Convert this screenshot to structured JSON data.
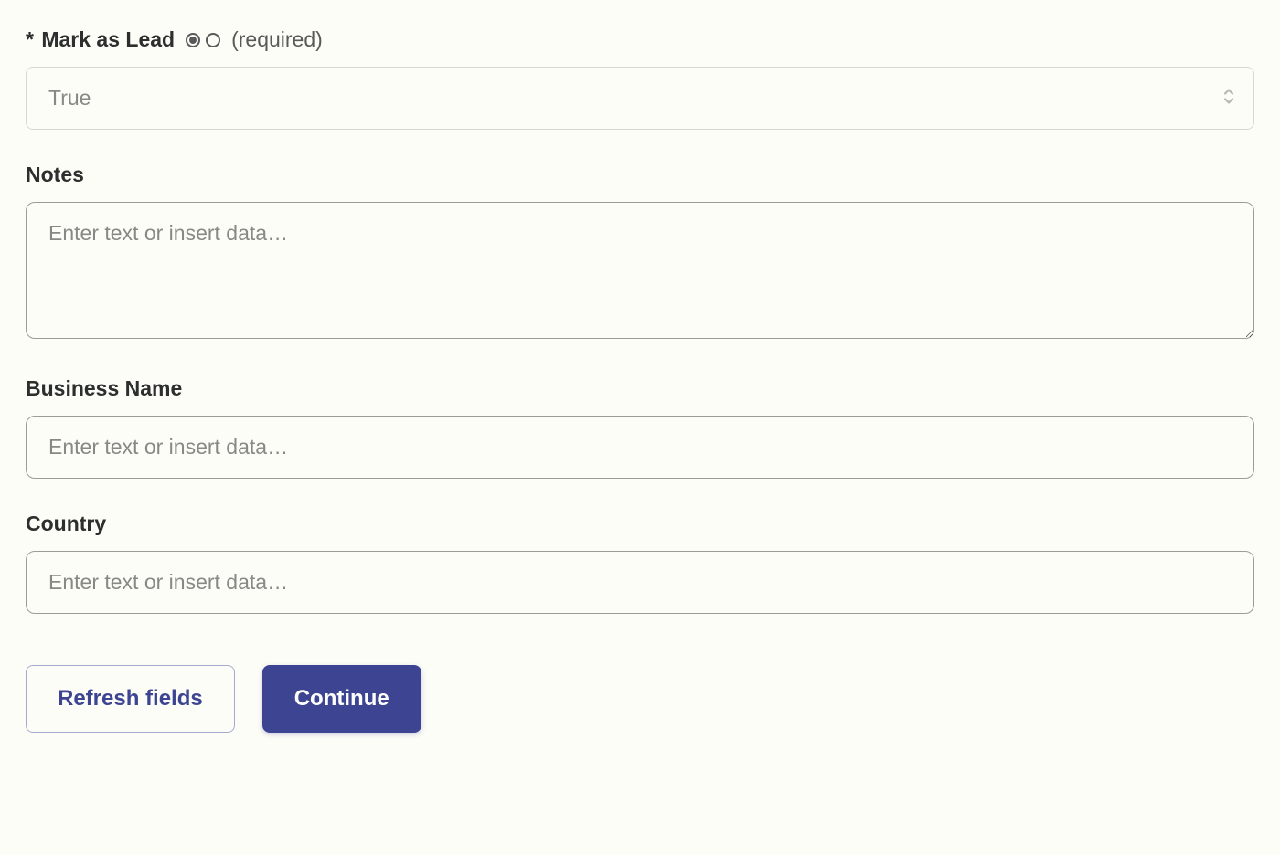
{
  "fields": {
    "mark_as_lead": {
      "required_star": "*",
      "label": "Mark as Lead",
      "required_text": "(required)",
      "value": "True"
    },
    "notes": {
      "label": "Notes",
      "placeholder": "Enter text or insert data…",
      "value": ""
    },
    "business_name": {
      "label": "Business Name",
      "placeholder": "Enter text or insert data…",
      "value": ""
    },
    "country": {
      "label": "Country",
      "placeholder": "Enter text or insert data…",
      "value": ""
    }
  },
  "buttons": {
    "refresh": "Refresh fields",
    "continue": "Continue"
  }
}
